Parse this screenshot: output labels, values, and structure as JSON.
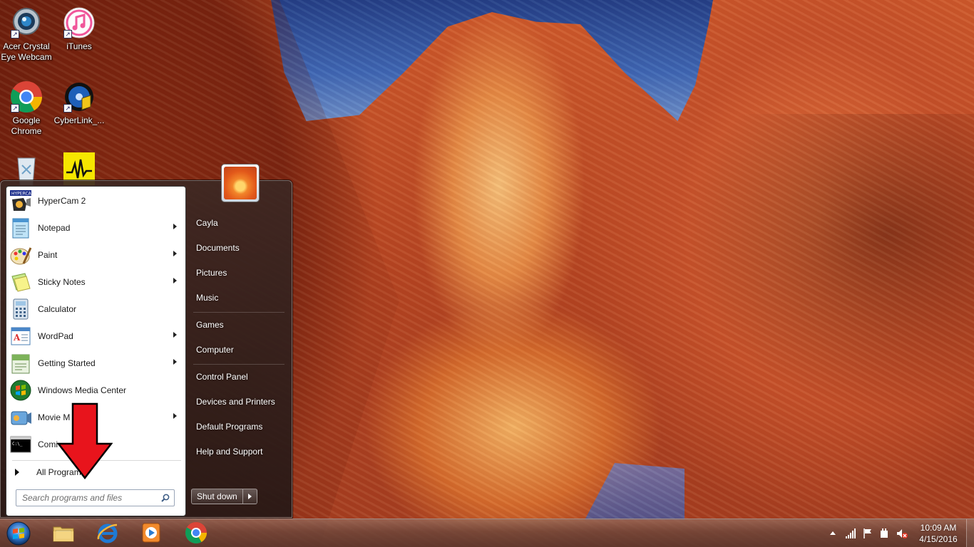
{
  "desktop": {
    "icons": [
      {
        "label": "Acer Crystal Eye Webcam",
        "icon": "webcam-icon"
      },
      {
        "label": "iTunes",
        "icon": "itunes-icon"
      },
      {
        "label": "Google Chrome",
        "icon": "chrome-icon"
      },
      {
        "label": "CyberLink_...",
        "icon": "cyberlink-icon"
      },
      {
        "label": "",
        "icon": "recycle-bin-icon"
      },
      {
        "label": "",
        "icon": "audio-app-icon"
      }
    ],
    "icon_lines": {
      "webcam_line1": "Acer Crystal",
      "webcam_line2": "Eye Webcam",
      "chrome_line1": "Google",
      "chrome_line2": "Chrome"
    }
  },
  "start_menu": {
    "programs": [
      {
        "label": "HyperCam 2",
        "icon": "hypercam-icon",
        "has_submenu": false
      },
      {
        "label": "Notepad",
        "icon": "notepad-icon",
        "has_submenu": true
      },
      {
        "label": "Paint",
        "icon": "paint-icon",
        "has_submenu": true
      },
      {
        "label": "Sticky Notes",
        "icon": "sticky-notes-icon",
        "has_submenu": true
      },
      {
        "label": "Calculator",
        "icon": "calculator-icon",
        "has_submenu": false
      },
      {
        "label": "WordPad",
        "icon": "wordpad-icon",
        "has_submenu": true
      },
      {
        "label": "Getting Started",
        "icon": "getting-started-icon",
        "has_submenu": true
      },
      {
        "label": "Windows Media Center",
        "icon": "media-center-icon",
        "has_submenu": false
      },
      {
        "label": "Movie M",
        "icon": "movie-maker-icon",
        "has_submenu": true
      },
      {
        "label": "Comi",
        "icon": "command-prompt-icon",
        "has_submenu": false
      }
    ],
    "all_programs_label": "All Program",
    "search_placeholder": "Search programs and files",
    "user_name": "Cayla",
    "right_links": [
      "Cayla",
      "Documents",
      "Pictures",
      "Music",
      "Games",
      "Computer",
      "Control Panel",
      "Devices and Printers",
      "Default Programs",
      "Help and Support"
    ],
    "shutdown_label": "Shut down"
  },
  "taskbar": {
    "pinned": [
      "windows-explorer-icon",
      "internet-explorer-icon",
      "media-player-icon",
      "chrome-icon"
    ],
    "tray_icons": [
      "show-hidden-icons-icon",
      "network-signal-icon",
      "action-center-flag-icon",
      "power-icon",
      "volume-muted-icon"
    ],
    "time": "10:09 AM",
    "date": "4/15/2016"
  },
  "colors": {
    "annotation_arrow": "#e8141c",
    "menu_background": "#3a2622"
  }
}
